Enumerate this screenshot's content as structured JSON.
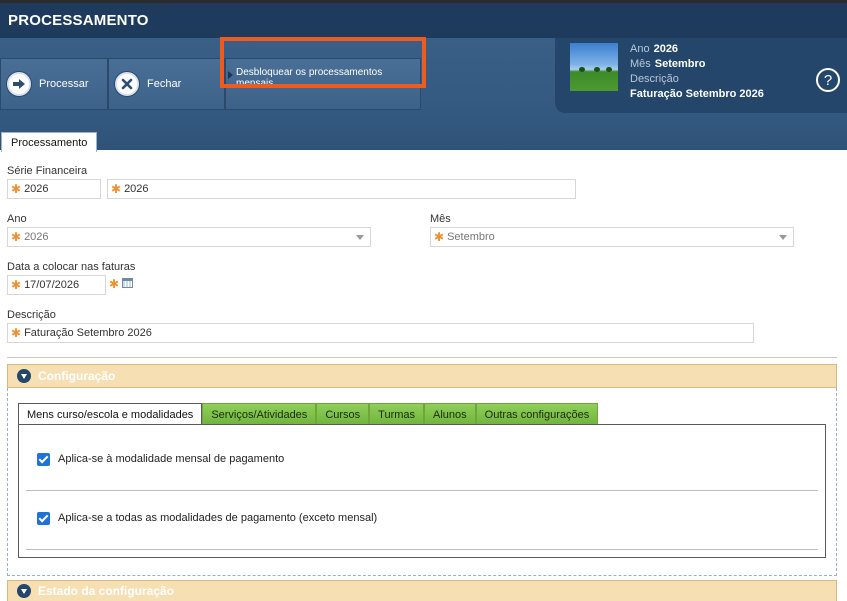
{
  "window": {
    "title": "PROCESSAMENTO"
  },
  "toolbar": {
    "processar": "Processar",
    "fechar": "Fechar",
    "desbloquear": "Desbloquear os processamentos mensais"
  },
  "info": {
    "ano_label": "Ano",
    "ano_value": "2026",
    "mes_label": "Mês",
    "mes_value": "Setembro",
    "descricao_label": "Descrição",
    "descricao_value": "Faturação Setembro 2026",
    "help": "?"
  },
  "tab": {
    "label": "Processamento"
  },
  "form": {
    "serie_label": "Série Financeira",
    "serie_value_1": "2026",
    "serie_value_2": "2026",
    "ano_label": "Ano",
    "ano_value": "2026",
    "mes_label": "Mês",
    "mes_value": "Setembro",
    "data_label": "Data a colocar nas faturas",
    "data_value": "17/07/2026",
    "descricao_label": "Descrição",
    "descricao_value": "Faturação Setembro 2026"
  },
  "sections": {
    "configuracao": "Configuração",
    "estado": "Estado da configuração"
  },
  "inner_tabs": [
    {
      "label": "Mens curso/escola e modalidades",
      "active": true
    },
    {
      "label": "Serviços/Atividades",
      "active": false
    },
    {
      "label": "Cursos",
      "active": false
    },
    {
      "label": "Turmas",
      "active": false
    },
    {
      "label": "Alunos",
      "active": false
    },
    {
      "label": "Outras configurações",
      "active": false
    }
  ],
  "options": {
    "mensal": {
      "label": "Aplica-se à modalidade mensal de pagamento",
      "checked": true
    },
    "todas": {
      "label": "Aplica-se a todas as modalidades de pagamento (exceto mensal)",
      "checked": true
    }
  },
  "colors": {
    "highlight": "#f05a1a",
    "brand": "#24466b",
    "tab_green": "#8fcf5a",
    "section_bg": "#f6dfb3"
  }
}
